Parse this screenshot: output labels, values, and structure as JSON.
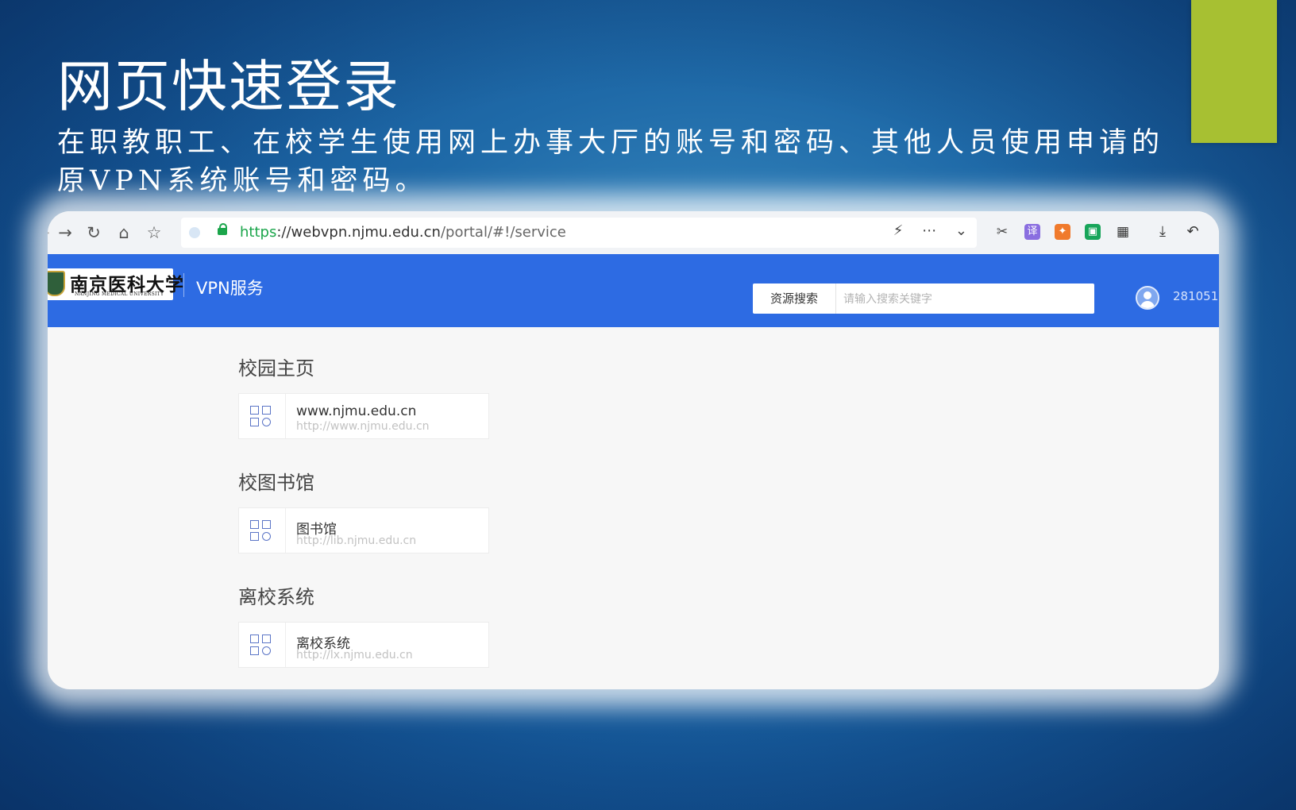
{
  "slide": {
    "title": "网页快速登录",
    "subtitle": "在职教职工、在校学生使用网上办事大厅的账号和密码、其他人员使用申请的原VPN系统账号和密码。",
    "accent_color": "#a7c032"
  },
  "browser": {
    "url_scheme": "https",
    "url_host": "://webvpn.njmu.edu.cn",
    "url_path": "/portal/#!/service",
    "nav_icons": [
      "back-icon",
      "forward-icon",
      "reload-icon",
      "home-icon",
      "favorites-icon"
    ],
    "action_icons": [
      "lightning-icon",
      "more-icon",
      "chevron-down-icon"
    ],
    "extension_icons": [
      "cut-icon",
      "translate-icon",
      "game-icon",
      "reader-icon",
      "apps-icon",
      "download-icon",
      "undo-icon"
    ],
    "translate_glyph": "译"
  },
  "header": {
    "logo_cn": "南京医科大学",
    "logo_en": "NANJING MEDICAL UNIVERSITY",
    "title": "VPN服务",
    "search_type": "资源搜索",
    "search_placeholder": "请输入搜索关键字",
    "search_value": "",
    "user": "281051",
    "brand_color": "#2d6be3"
  },
  "sections": [
    {
      "title": "校园主页",
      "cards": [
        {
          "name": "www.njmu.edu.cn",
          "url": "http://www.njmu.edu.cn"
        }
      ]
    },
    {
      "title": "校图书馆",
      "cards": [
        {
          "name": "图书馆",
          "url": "http://lib.njmu.edu.cn"
        }
      ]
    },
    {
      "title": "离校系统",
      "cards": [
        {
          "name": "离校系统",
          "url": "http://lx.njmu.edu.cn"
        }
      ]
    }
  ]
}
